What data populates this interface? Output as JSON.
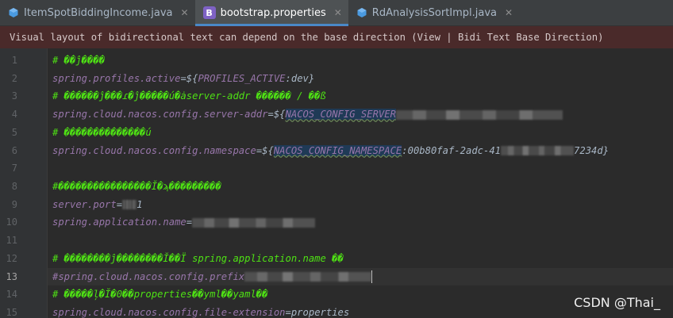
{
  "tabs": [
    {
      "label": "ItemSpotBiddingIncome.java",
      "active": false,
      "icon": "java-class-icon"
    },
    {
      "label": "bootstrap.properties",
      "active": true,
      "icon": "properties-file-icon"
    },
    {
      "label": "RdAnalysisSortImpl.java",
      "active": false,
      "icon": "java-class-icon"
    }
  ],
  "tab_close_glyph": "✕",
  "properties_icon_letter": "B",
  "banner": {
    "text": "Visual layout of bidirectional text can depend on the base direction (View | Bidi Text Base Direction)"
  },
  "lines": {
    "n1": "1",
    "n2": "2",
    "n3": "3",
    "n4": "4",
    "n5": "5",
    "n6": "6",
    "n7": "7",
    "n8": "8",
    "n9": "9",
    "n10": "10",
    "n11": "11",
    "n12": "12",
    "n13": "13",
    "n14": "14",
    "n15": "15"
  },
  "code": {
    "l1": "# ��ĵ����",
    "l2_key": "spring.profiles.active",
    "l2_eq": "=${",
    "l2_var": "PROFILES_ACTIVE",
    "l2_tail": ":dev}",
    "l3": "# ������ĵ���ɾ�ĵ�����ú�ȧserver-addr ������ / ��ß",
    "l4_key": "spring.cloud.nacos.config.server-addr",
    "l4_eq": "=${",
    "l4_var": "NACOS_CONFIG_SERVER",
    "l5": "# ��������������ú",
    "l6_key": "spring.cloud.nacos.config.namespace",
    "l6_eq": "=${",
    "l6_var": "NACOS_CONFIG_NAMESPACE",
    "l6_val1": ":00b80faf-2adc-41",
    "l6_val2": "7234d}",
    "l8": "#����������������Ĭ�ϡ���������",
    "l9_key": "server.port",
    "l9_eq": "=",
    "l9_val": "1",
    "l10_key": "spring.application.name",
    "l10_eq": "=",
    "l12": "# ��������ĵ��������Ĭ��Ï spring.application.name ��",
    "l13_key": "#spring.cloud.nacos.config.prefix",
    "l14": "# �����ļ�Ĭ�0��properties��yml��yaml��",
    "l15_key": "spring.cloud.nacos.config.file-extension",
    "l15_eq": "=",
    "l15_val": "properties"
  },
  "colors": {
    "comment": "#4ee014",
    "key": "#9876aa",
    "value": "#a9b7c6",
    "banner_bg": "#4a2a2a",
    "active_tab_underline": "#4a88c7"
  },
  "current_line": 13,
  "watermark": "CSDN @Thai_"
}
